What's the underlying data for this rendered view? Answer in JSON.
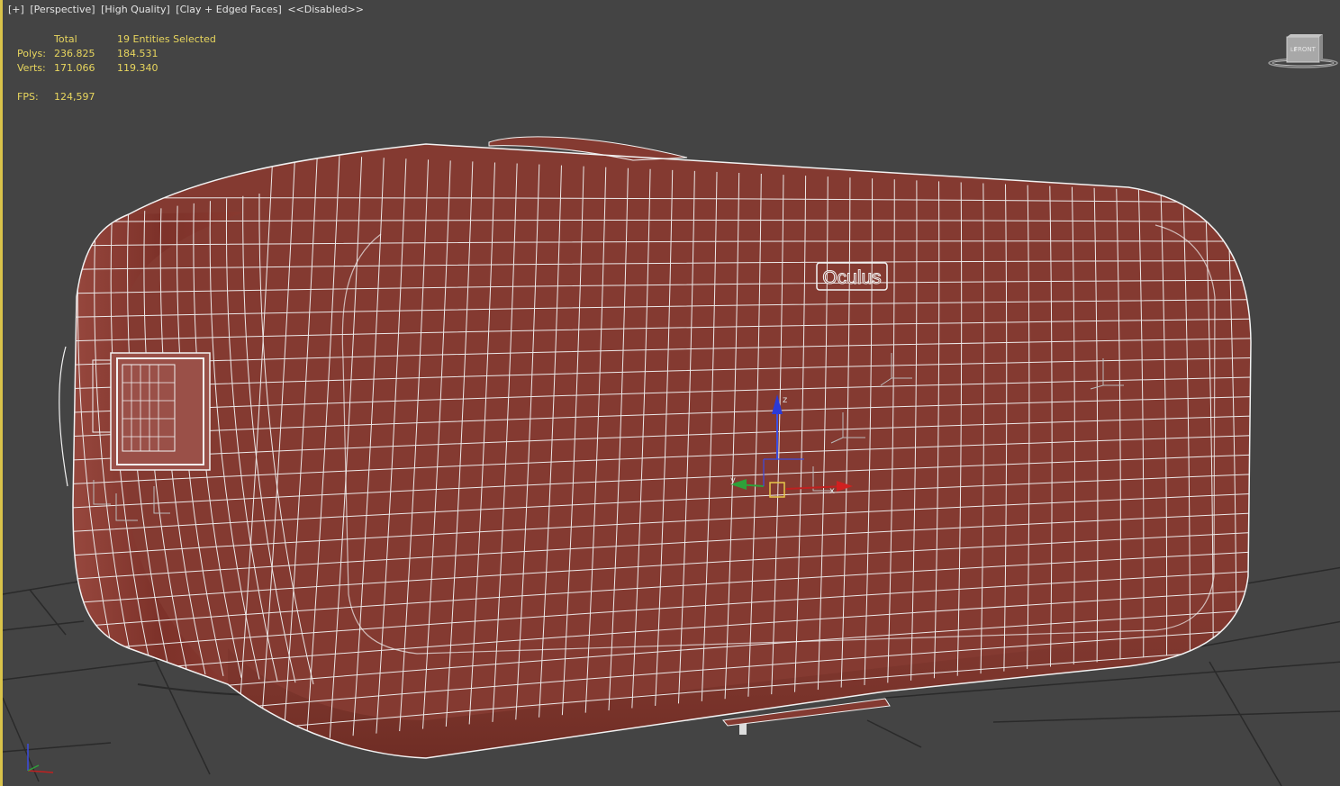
{
  "viewport_labels": {
    "plus": "[+]",
    "view": "[Perspective]",
    "quality": "[High Quality]",
    "shading": "[Clay + Edged Faces]",
    "disabled": "<<Disabled>>"
  },
  "stats": {
    "col_total": "Total",
    "col_selected": "19 Entities Selected",
    "polys_label": "Polys:",
    "polys_total": "236.825",
    "polys_selected": "184.531",
    "verts_label": "Verts:",
    "verts_total": "171.066",
    "verts_selected": "119.340",
    "fps_label": "FPS:",
    "fps_value": "124,597"
  },
  "model": {
    "logo_text": "Oculus",
    "body_color": "#843a31",
    "wire_color": "#f2f2f2"
  },
  "viewcube": {
    "face_label": "FRONT",
    "side_label": "LE"
  },
  "gizmo": {
    "x_label": "x",
    "y_label": "y",
    "z_label": "z"
  },
  "colors": {
    "background": "#444444",
    "stats_text": "#e8d65e",
    "label_text": "#e3e3e3",
    "active_border": "#d9c34a"
  }
}
